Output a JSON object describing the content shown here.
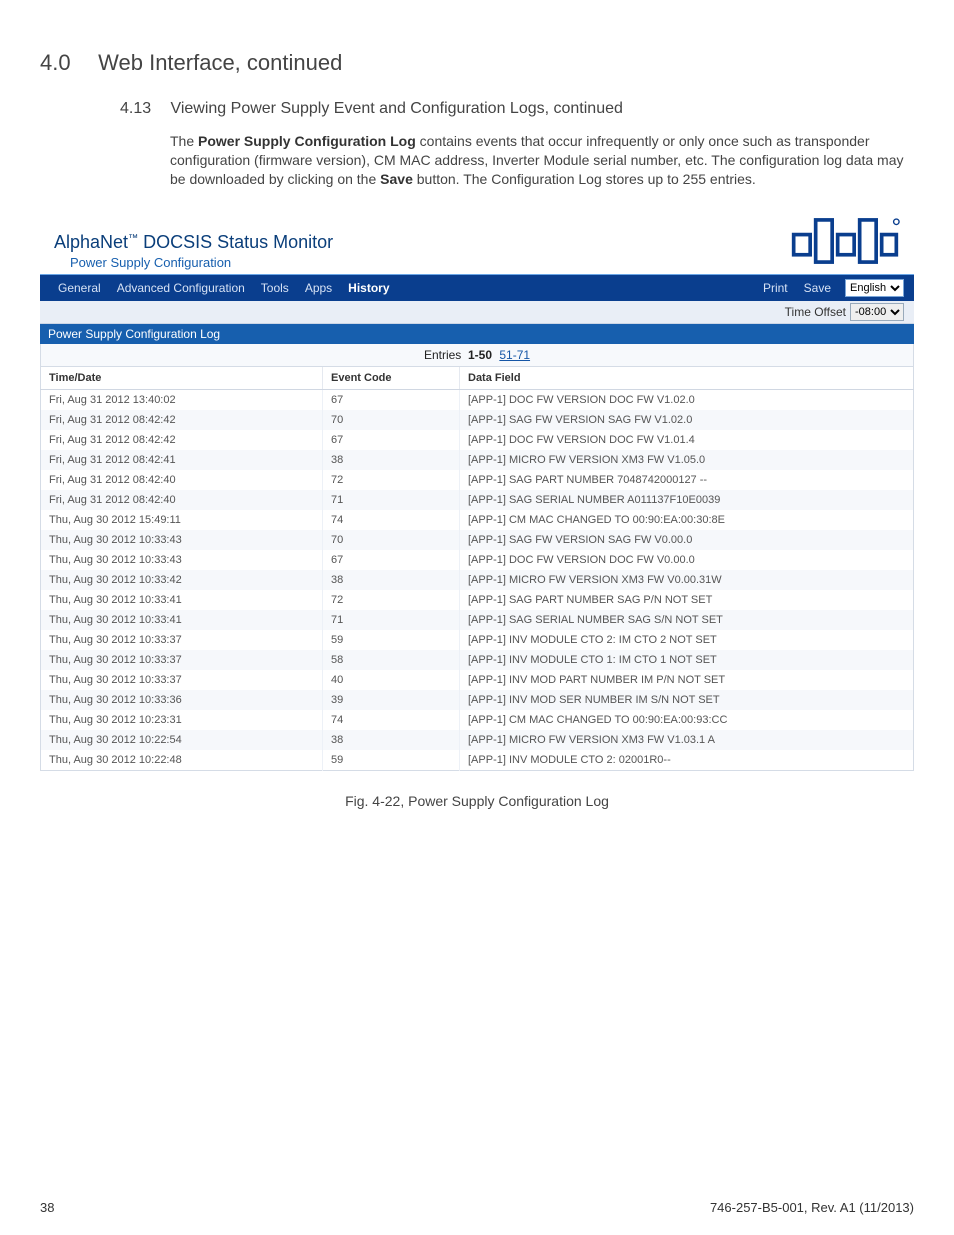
{
  "heading1": {
    "num": "4.0",
    "text": "Web Interface, continued"
  },
  "heading2": {
    "num": "4.13",
    "text": "Viewing Power Supply Event and Configuration Logs, continued"
  },
  "para": {
    "pre": "The ",
    "bold1": "Power Supply Configuration Log",
    "mid": " contains events that occur infrequently or only once such as transponder configuration (firmware version), CM MAC address, Inverter Module serial number, etc. The configuration log data may be downloaded by clicking on the ",
    "bold2": "Save",
    "post": " button. The Configuration Log stores up to 255 entries."
  },
  "brand": {
    "title_a": "AlphaNet",
    "tm": "™",
    "title_b": " DOCSIS Status Monitor",
    "sub": "Power Supply Configuration"
  },
  "nav": {
    "general": "General",
    "advanced": "Advanced Configuration",
    "tools": "Tools",
    "apps": "Apps",
    "history": "History",
    "print": "Print",
    "save": "Save",
    "lang": "English"
  },
  "subbar": {
    "label": "Time Offset",
    "value": "-08:00"
  },
  "section_title": "Power Supply Configuration Log",
  "pager": {
    "label": "Entries",
    "current": "1-50",
    "next": "51-71"
  },
  "cols": {
    "time": "Time/Date",
    "code": "Event Code",
    "data": "Data Field"
  },
  "rows": [
    {
      "t": "Fri, Aug 31 2012 13:40:02",
      "c": "67",
      "d": "[APP-1] DOC FW VERSION DOC FW V1.02.0"
    },
    {
      "t": "Fri, Aug 31 2012 08:42:42",
      "c": "70",
      "d": "[APP-1] SAG FW VERSION SAG FW V1.02.0"
    },
    {
      "t": "Fri, Aug 31 2012 08:42:42",
      "c": "67",
      "d": "[APP-1] DOC FW VERSION DOC FW V1.01.4"
    },
    {
      "t": "Fri, Aug 31 2012 08:42:41",
      "c": "38",
      "d": "[APP-1] MICRO FW VERSION XM3 FW V1.05.0"
    },
    {
      "t": "Fri, Aug 31 2012 08:42:40",
      "c": "72",
      "d": "[APP-1] SAG PART NUMBER 7048742000127 --"
    },
    {
      "t": "Fri, Aug 31 2012 08:42:40",
      "c": "71",
      "d": "[APP-1] SAG SERIAL NUMBER A011137F10E0039"
    },
    {
      "t": "Thu, Aug 30 2012 15:49:11",
      "c": "74",
      "d": "[APP-1] CM MAC CHANGED TO 00:90:EA:00:30:8E"
    },
    {
      "t": "Thu, Aug 30 2012 10:33:43",
      "c": "70",
      "d": "[APP-1] SAG FW VERSION SAG FW V0.00.0"
    },
    {
      "t": "Thu, Aug 30 2012 10:33:43",
      "c": "67",
      "d": "[APP-1] DOC FW VERSION DOC FW V0.00.0"
    },
    {
      "t": "Thu, Aug 30 2012 10:33:42",
      "c": "38",
      "d": "[APP-1] MICRO FW VERSION XM3 FW V0.00.31W"
    },
    {
      "t": "Thu, Aug 30 2012 10:33:41",
      "c": "72",
      "d": "[APP-1] SAG PART NUMBER SAG P/N NOT SET"
    },
    {
      "t": "Thu, Aug 30 2012 10:33:41",
      "c": "71",
      "d": "[APP-1] SAG SERIAL NUMBER SAG S/N NOT SET"
    },
    {
      "t": "Thu, Aug 30 2012 10:33:37",
      "c": "59",
      "d": "[APP-1] INV MODULE CTO 2: IM CTO 2 NOT SET"
    },
    {
      "t": "Thu, Aug 30 2012 10:33:37",
      "c": "58",
      "d": "[APP-1] INV MODULE CTO 1: IM CTO 1 NOT SET"
    },
    {
      "t": "Thu, Aug 30 2012 10:33:37",
      "c": "40",
      "d": "[APP-1] INV MOD PART NUMBER IM P/N NOT SET"
    },
    {
      "t": "Thu, Aug 30 2012 10:33:36",
      "c": "39",
      "d": "[APP-1] INV MOD SER NUMBER IM S/N NOT SET"
    },
    {
      "t": "Thu, Aug 30 2012 10:23:31",
      "c": "74",
      "d": "[APP-1] CM MAC CHANGED TO 00:90:EA:00:93:CC"
    },
    {
      "t": "Thu, Aug 30 2012 10:22:54",
      "c": "38",
      "d": "[APP-1] MICRO FW VERSION XM3 FW V1.03.1 A"
    },
    {
      "t": "Thu, Aug 30 2012 10:22:48",
      "c": "59",
      "d": "[APP-1] INV MODULE CTO 2: 02001R0--"
    }
  ],
  "fig_caption": "Fig. 4-22, Power Supply Configuration Log",
  "footer": {
    "page": "38",
    "docid": "746-257-B5-001, Rev. A1 (11/2013)"
  }
}
